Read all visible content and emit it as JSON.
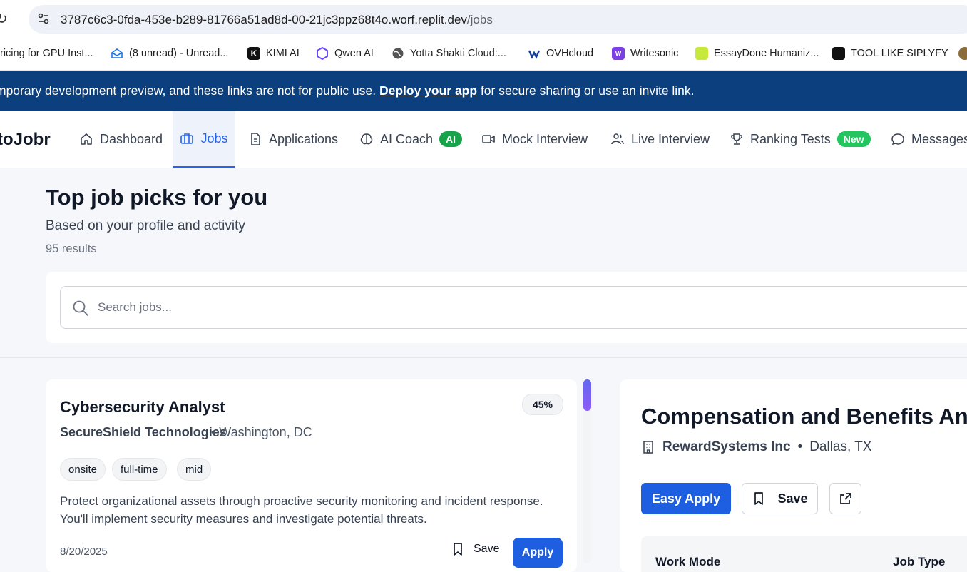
{
  "browser": {
    "url_host": "3787c6c3-0fda-453e-b289-81766a51ad8d-00-21jc3ppz68t4o.worf.replit.dev",
    "url_path": "/jobs",
    "bookmarks": [
      {
        "label": "ricing for GPU Inst...",
        "icon": "page-icon"
      },
      {
        "label": "(8 unread) - Unread...",
        "icon": "mail-icon"
      },
      {
        "label": "KIMI AI",
        "icon": "kimi-icon"
      },
      {
        "label": "Qwen AI",
        "icon": "qwen-icon"
      },
      {
        "label": "Yotta Shakti Cloud:...",
        "icon": "globe-icon"
      },
      {
        "label": "OVHcloud",
        "icon": "ovh-icon"
      },
      {
        "label": "Writesonic",
        "icon": "writesonic-icon"
      },
      {
        "label": "EssayDone Humaniz...",
        "icon": "essaydone-icon"
      },
      {
        "label": "TOOL LIKE SIPLYFY",
        "icon": "tool-icon"
      }
    ]
  },
  "banner": {
    "text_before": "mporary development preview, and these links are not for public use.",
    "link": "Deploy your app",
    "text_after": "for secure sharing or use an invite link."
  },
  "nav": {
    "brand": "toJobr",
    "items": [
      {
        "label": "Dashboard",
        "icon": "home-icon"
      },
      {
        "label": "Jobs",
        "icon": "briefcase-icon",
        "active": true
      },
      {
        "label": "Applications",
        "icon": "document-icon"
      },
      {
        "label": "AI Coach",
        "icon": "brain-icon",
        "badge": "AI"
      },
      {
        "label": "Mock Interview",
        "icon": "video-icon"
      },
      {
        "label": "Live Interview",
        "icon": "users-icon"
      },
      {
        "label": "Ranking Tests",
        "icon": "trophy-icon",
        "badge": "New"
      },
      {
        "label": "Messages",
        "icon": "message-icon"
      }
    ]
  },
  "header": {
    "title": "Top job picks for you",
    "subtitle": "Based on your profile and activity",
    "results": "95 results"
  },
  "search": {
    "placeholder": "Search jobs..."
  },
  "job": {
    "title": "Cybersecurity Analyst",
    "match": "45%",
    "company": "SecureShield Technologies",
    "location": "• Washington, DC",
    "tags": [
      "onsite",
      "full-time",
      "mid"
    ],
    "description": "Protect organizational assets through proactive security monitoring and incident response. You'll implement security measures and investigate potential threats.",
    "date": "8/20/2025",
    "save_label": "Save",
    "apply_label": "Apply"
  },
  "detail": {
    "title": "Compensation and Benefits Anal",
    "company": "RewardSystems Inc",
    "location": "Dallas, TX",
    "easy_apply_label": "Easy Apply",
    "save_label": "Save",
    "work_mode_label": "Work Mode",
    "job_type_label": "Job Type"
  },
  "colors": {
    "primary": "#1d5fe0",
    "banner": "#0b3f7d",
    "badge_green": "#16a34a"
  }
}
